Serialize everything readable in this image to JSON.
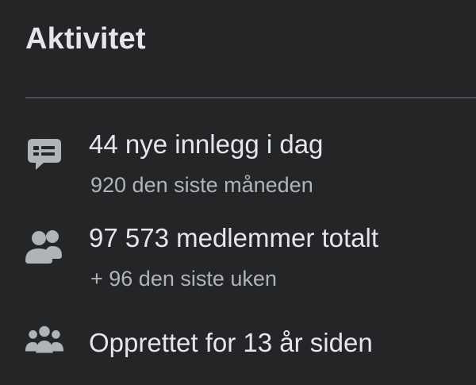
{
  "panel": {
    "title": "Aktivitet"
  },
  "stats": {
    "posts": {
      "icon": "chat-bubble-icon",
      "primary": "44 nye innlegg i dag",
      "secondary": "920 den siste måneden"
    },
    "members": {
      "icon": "people-icon",
      "primary": "97 573 medlemmer totalt",
      "secondary": "+ 96 den siste uken"
    },
    "created": {
      "icon": "group-icon",
      "primary": "Opprettet for 13 år siden"
    }
  },
  "colors": {
    "background": "#242526",
    "primary_text": "#e4e6eb",
    "secondary_text": "#b0b3b8",
    "icon": "#b0b3b8",
    "divider": "#4b4c4f"
  }
}
